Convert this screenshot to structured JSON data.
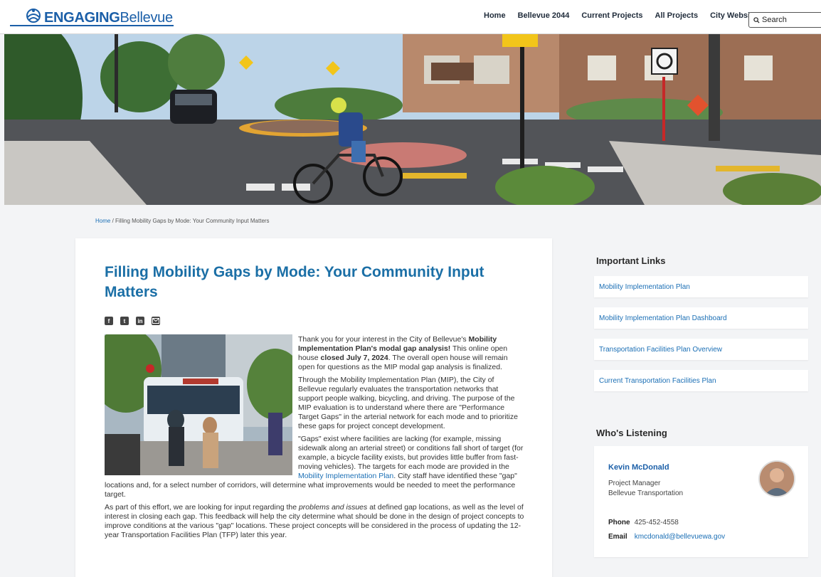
{
  "header": {
    "logo_bold": "ENGAGING",
    "logo_light": "Bellevue",
    "nav": [
      "Home",
      "Bellevue 2044",
      "Current Projects",
      "All Projects",
      "City Website"
    ],
    "search_label": "Search"
  },
  "breadcrumb": {
    "home": "Home",
    "separator": " / ",
    "current": "Filling Mobility Gaps by Mode: Your Community Input Matters"
  },
  "article": {
    "title": "Filling Mobility Gaps by Mode: Your Community Input Matters",
    "share_icons": [
      "facebook-icon",
      "twitter-icon",
      "linkedin-icon",
      "email-icon"
    ],
    "p1_a": "Thank you for your interest in the City of Bellevue's ",
    "p1_b": "Mobility Implementation Plan's modal gap analysis!",
    "p1_c": " This online open house ",
    "p1_d": "closed July 7, 2024",
    "p1_e": ". The overall open house will remain open for questions as the MIP modal gap analysis is finalized.",
    "p2": "Through the Mobility Implementation Plan (MIP), the City of Bellevue regularly evaluates the transportation networks that support people walking, bicycling, and driving. The purpose of the MIP evaluation is to understand where there are \"Performance Target Gaps\" in the arterial network for each mode and to prioritize these gaps for project concept development.",
    "p3_a": "\"Gaps\" exist where facilities are lacking (for example, missing sidewalk along an arterial street) or conditions fall short of target (for example, a bicycle facility exists, but provides little buffer from fast-moving vehicles). The targets for each mode are provided in the ",
    "p3_link": "Mobility Implementation Plan",
    "p3_b": ". City staff have identified these \"gap\" locations and, for a select number of corridors, will determine what improvements would be needed to meet the performance target.",
    "p4_a": "As part of this effort, we are looking for input regarding the ",
    "p4_em": "problems and issues",
    "p4_b": " at defined gap locations, as well as the level of interest in closing each gap. This feedback will help the city determine what should be done in the design of project concepts to improve conditions at the various \"gap\" locations. These project concepts will be considered in the process of updating the 12-year Transportation Facilities Plan (TFP) later this year."
  },
  "sidebar": {
    "links_heading": "Important Links",
    "links": [
      "Mobility Implementation Plan",
      "Mobility Implementation Plan Dashboard",
      "Transportation Facilities Plan Overview",
      "Current Transportation Facilities Plan"
    ],
    "listening_heading": "Who's Listening",
    "contact": {
      "name": "Kevin McDonald",
      "role": "Project Manager",
      "org": "Bellevue Transportation",
      "phone_label": "Phone",
      "phone": "425-452-4558",
      "email_label": "Email",
      "email": "kmcdonald@bellevuewa.gov"
    }
  },
  "colors": {
    "brand": "#1b5fa8",
    "link": "#1b6fb5",
    "title": "#1b6fa6",
    "page_bg": "#f3f4f6"
  }
}
